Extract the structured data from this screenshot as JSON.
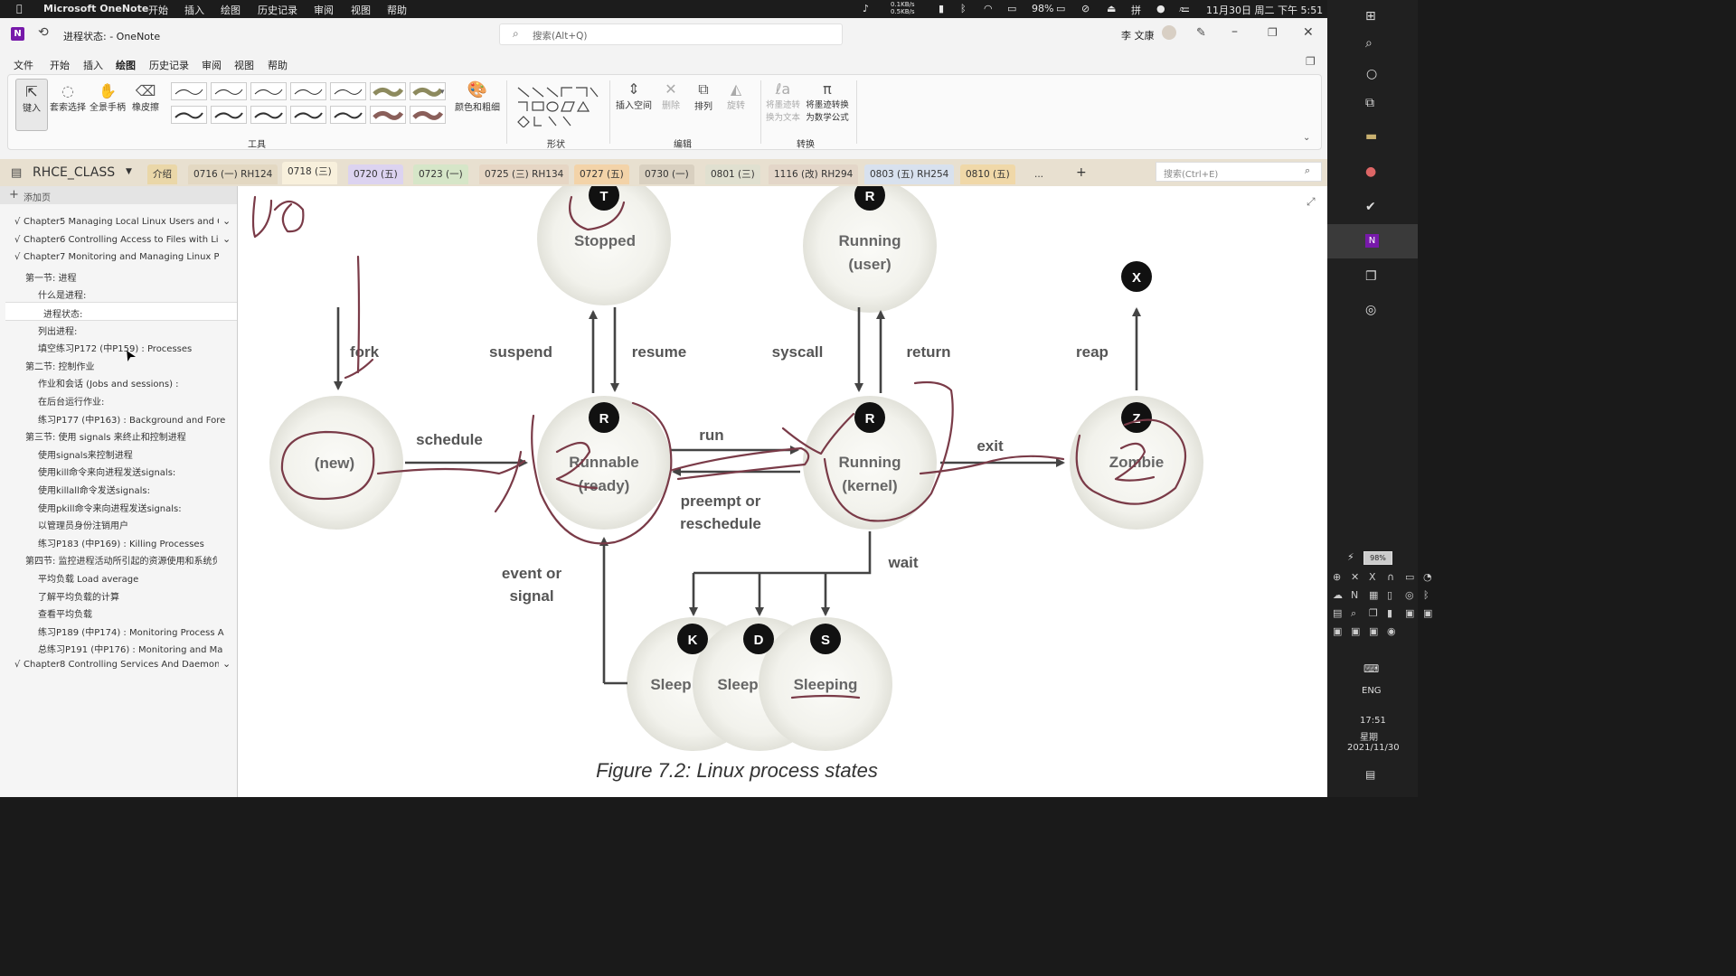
{
  "menubar": {
    "apple": "",
    "app_name": "Microsoft OneNote",
    "menus": [
      "开始",
      "插入",
      "绘图",
      "历史记录",
      "审阅",
      "视图",
      "帮助"
    ],
    "net_up": "0.1KB/s",
    "net_down": "0.5KB/s",
    "battery": "98%",
    "clock": "11月30日 周二 下午 5:51"
  },
  "window": {
    "title": "进程状态: - OneNote",
    "search_placeholder": "搜索(Alt+Q)",
    "user": "李 文康"
  },
  "ribbon_tabs": [
    "文件",
    "开始",
    "插入",
    "绘图",
    "历史记录",
    "审阅",
    "视图",
    "帮助"
  ],
  "ribbon_active": "绘图",
  "ribbon": {
    "tools": [
      "键入",
      "套索选择",
      "全景手柄",
      "橡皮擦"
    ],
    "color_thickness": "颜色和粗细",
    "group_tools": "工具",
    "group_shapes": "形状",
    "insert_space": "插入空间",
    "delete": "删除",
    "arrange": "排列",
    "rotate": "旋转",
    "group_edit": "编辑",
    "ink_to_text": "将墨迹转换为文本",
    "ink_to_math": "将墨迹转换为数学公式",
    "group_convert": "转换"
  },
  "notebook": {
    "name": "RHCE_CLASS",
    "sections": [
      "介绍",
      "0716 (一) RH124",
      "0718 (三)",
      "0720 (五)",
      "0723 (一)",
      "0725 (三) RH134",
      "0727 (五)",
      "0730 (一)",
      "0801 (三)",
      "1116 (改) RH294",
      "0803 (五) RH254",
      "0810 (五)",
      "..."
    ],
    "search_placeholder": "搜索(Ctrl+E)"
  },
  "sidebar": {
    "add_page": "添加页",
    "pages": [
      {
        "text": "Chapter5 Managing Local Linux Users and Gr",
        "level": 0
      },
      {
        "text": "Chapter6 Controlling Access to Files with Linu",
        "level": 0
      },
      {
        "text": "Chapter7 Monitoring and Managing Linux Proc",
        "level": 0
      },
      {
        "text": "第一节: 进程",
        "level": 1
      },
      {
        "text": "什么是进程:",
        "level": 2
      },
      {
        "text": "进程状态:",
        "level": 2
      },
      {
        "text": "列出进程:",
        "level": 2
      },
      {
        "text": "填空练习P172 (中P159) :   Processes",
        "level": 2
      },
      {
        "text": "第二节: 控制作业",
        "level": 1
      },
      {
        "text": "作业和会话 (Jobs and sessions) :",
        "level": 2
      },
      {
        "text": "在后台运行作业:",
        "level": 2
      },
      {
        "text": "练习P177 (中P163) :   Background and Fore",
        "level": 2
      },
      {
        "text": "第三节: 使用 signals 来终止和控制进程",
        "level": 1
      },
      {
        "text": "使用signals来控制进程",
        "level": 2
      },
      {
        "text": "使用kill命令来向进程发送signals:",
        "level": 2
      },
      {
        "text": "使用killall命令发送signals:",
        "level": 2
      },
      {
        "text": "使用pkill命令来向进程发送signals:",
        "level": 2
      },
      {
        "text": "以管理员身份注销用户",
        "level": 2
      },
      {
        "text": "练习P183 (中P169) :   Killing Processes",
        "level": 2
      },
      {
        "text": "第四节: 监控进程活动所引起的资源使用和系统负",
        "level": 1
      },
      {
        "text": "平均负载 Load average",
        "level": 2
      },
      {
        "text": "了解平均负载的计算",
        "level": 2
      },
      {
        "text": "查看平均负载",
        "level": 2
      },
      {
        "text": "练习P189 (中P174) :   Monitoring Process A",
        "level": 2
      },
      {
        "text": "总练习P191 (中P176) :   Monitoring and Ma",
        "level": 2
      },
      {
        "text": "Chapter8 Controlling Services And Daemons",
        "level": 0
      }
    ],
    "selected": "进程状态:"
  },
  "diagram": {
    "states": {
      "stopped": "Stopped",
      "running_user": [
        "Running",
        "(user)"
      ],
      "new": "(new)",
      "runnable": [
        "Runnable",
        "(ready)"
      ],
      "running_kernel": [
        "Running",
        "(kernel)"
      ],
      "zombie": "Zombie",
      "sleep_k": "Sleep",
      "sleep_d": "Sleep",
      "sleeping_s": "Sleeping"
    },
    "badges": {
      "stopped": "T",
      "running_user": "R",
      "runnable": "R",
      "running_kernel": "R",
      "zombie": "Z",
      "x": "X",
      "k": "K",
      "d": "D",
      "s": "S"
    },
    "labels": {
      "fork": "fork",
      "schedule": "schedule",
      "suspend": "suspend",
      "resume": "resume",
      "syscall": "syscall",
      "return": "return",
      "reap": "reap",
      "run": "run",
      "preempt1": "preempt or",
      "preempt2": "reschedule",
      "exit": "exit",
      "wait": "wait",
      "event1": "event or",
      "event2": "signal"
    },
    "caption": "Figure 7.2: Linux process states"
  },
  "taskbar": {
    "battery": "98%",
    "ime": "ENG",
    "time": "17:51",
    "weekday": "星期",
    "date": "2021/11/30"
  },
  "colors": {
    "accent": "#7719aa",
    "ink": "#7a3b48",
    "notebook_bar": "#e8e0d0"
  }
}
